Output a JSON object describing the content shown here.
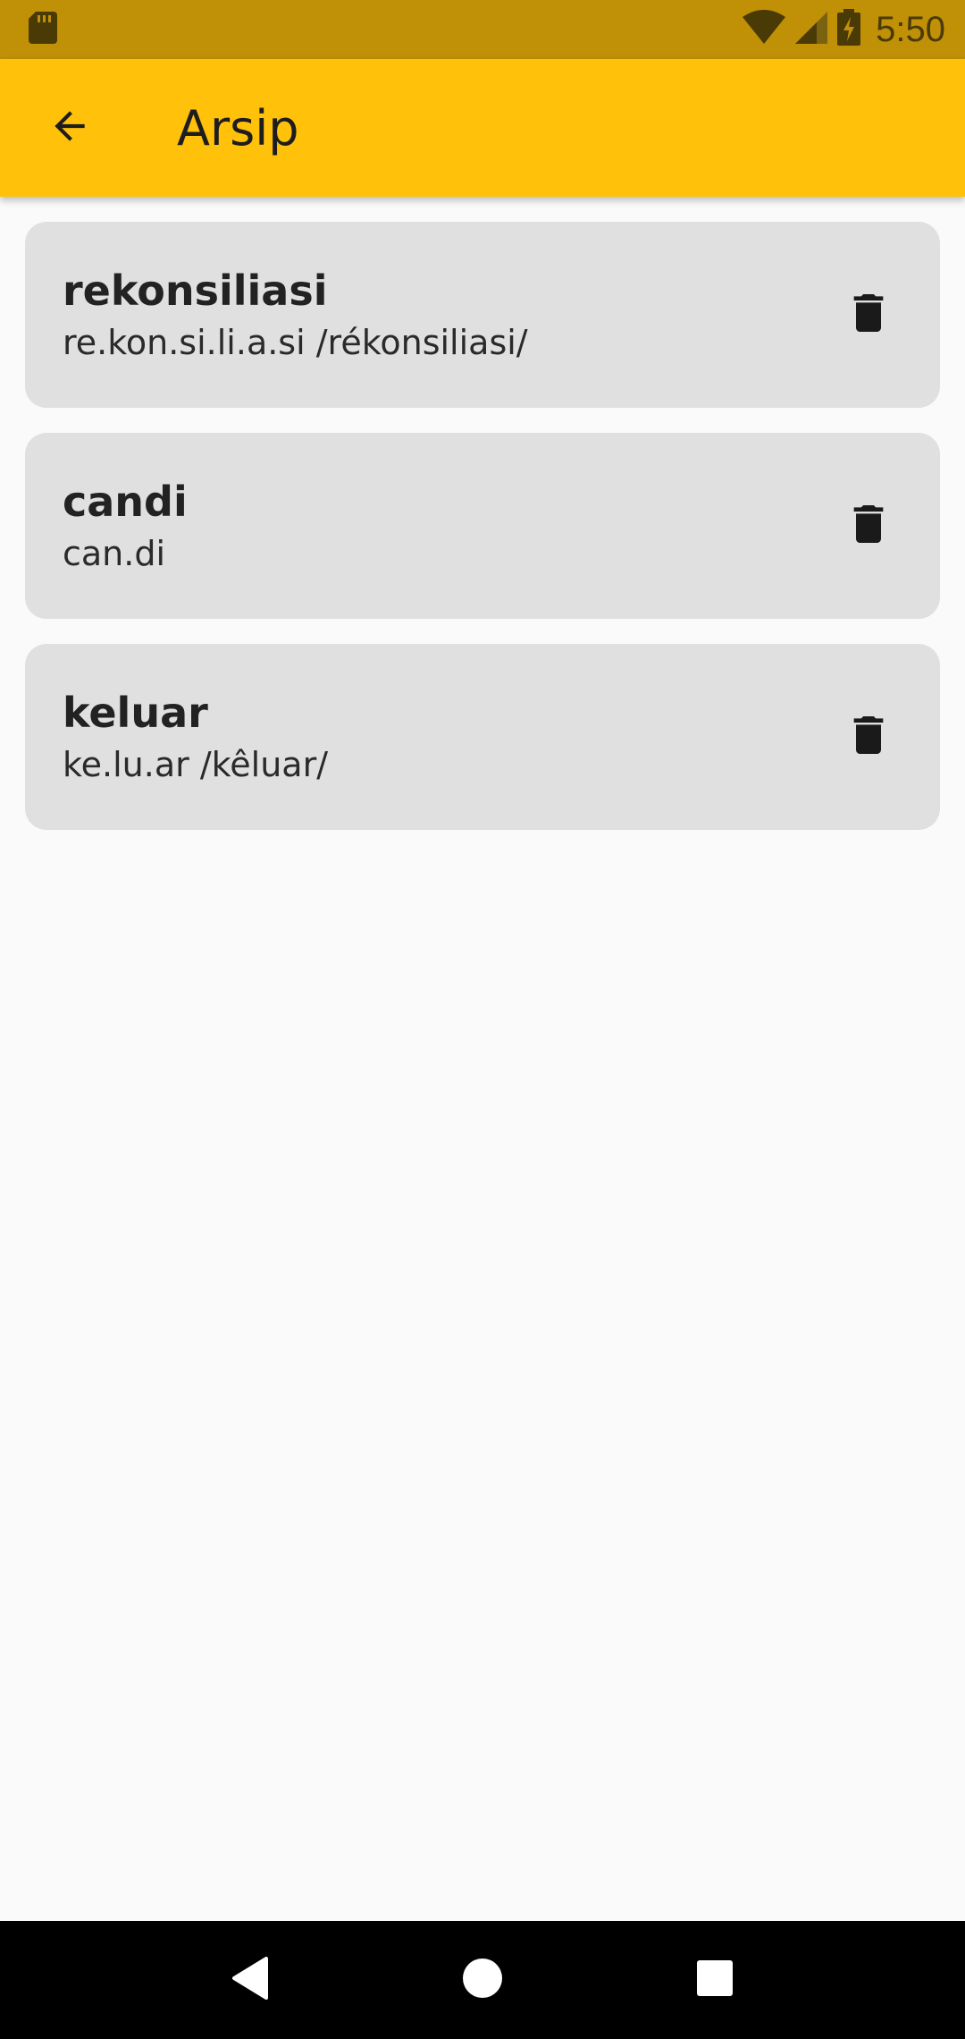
{
  "status_bar": {
    "time": "5:50",
    "icons": [
      "sd-card-icon",
      "wifi-icon",
      "cell-signal-icon",
      "battery-charging-icon"
    ]
  },
  "app_bar": {
    "title": "Arsip",
    "back_icon": "arrow-back-icon",
    "background": "#ffc10a"
  },
  "archive": {
    "items": [
      {
        "word": "rekonsiliasi",
        "pronunciation": "re.kon.si.li.a.si /rékonsiliasi/",
        "action_icon": "trash-icon"
      },
      {
        "word": "candi",
        "pronunciation": "can.di",
        "action_icon": "trash-icon"
      },
      {
        "word": "keluar",
        "pronunciation": "ke.lu.ar /kêluar/",
        "action_icon": "trash-icon"
      }
    ]
  },
  "nav_bar": {
    "buttons": [
      "back-triangle-icon",
      "home-circle-icon",
      "recents-square-icon"
    ]
  }
}
